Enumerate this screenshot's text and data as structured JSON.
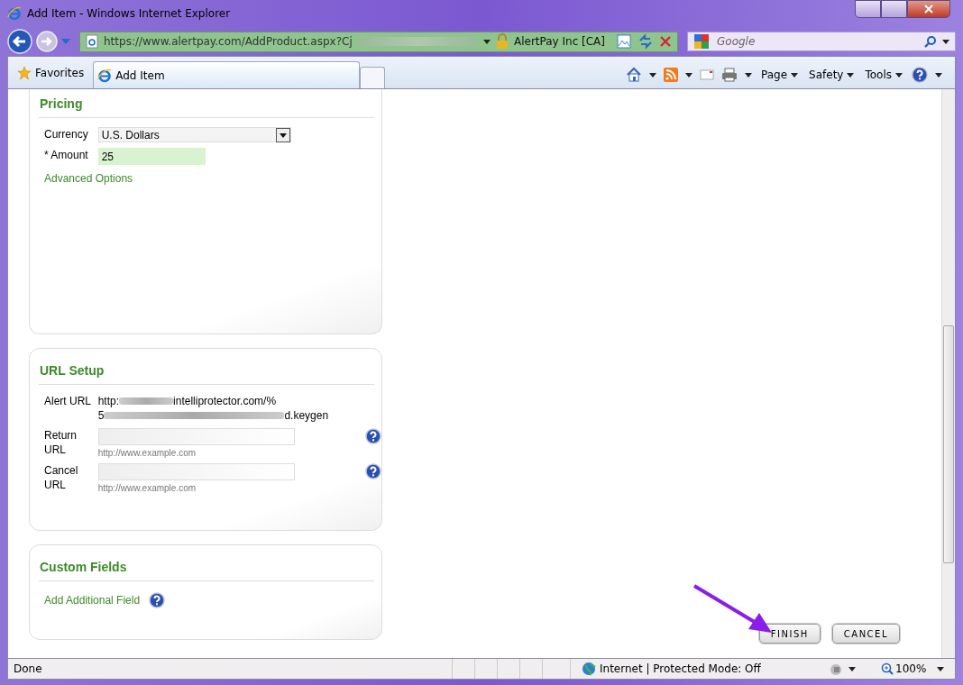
{
  "window": {
    "title": "Add Item - Windows Internet Explorer"
  },
  "address_bar": {
    "url_start": "https://www.alertpay.com/AddProduct.aspx?Cj",
    "security_label": "AlertPay Inc [CA]"
  },
  "search": {
    "placeholder": "Google"
  },
  "favorites": {
    "label": "Favorites"
  },
  "tabs": [
    {
      "label": "Add Item",
      "selected": true
    }
  ],
  "command_bar": {
    "menus": [
      "Page",
      "Safety",
      "Tools"
    ]
  },
  "sections": [
    {
      "kind": "pricing",
      "title": "Pricing",
      "cut_top": true,
      "rows": [
        {
          "kind": "select",
          "label": "Currency",
          "value": "U.S. Dollars"
        },
        {
          "kind": "input",
          "label": "* Amount",
          "value": "25",
          "highlighted": true
        }
      ],
      "links": [
        {
          "label": "Advanced Options",
          "help": false
        }
      ]
    },
    {
      "kind": "url_setup",
      "title": "URL Setup",
      "rows": [
        {
          "kind": "text",
          "label": "Alert URL",
          "lines": [
            {
              "before": "http:",
              "after": "intelliprotector.com/%"
            },
            {
              "before": "5",
              "after": "d.keygen"
            }
          ]
        },
        {
          "kind": "input",
          "label": "Return URL",
          "value_hint": "http://www.example.com",
          "help": true
        },
        {
          "kind": "input",
          "label": "Cancel URL",
          "value_hint": "http://www.example.com",
          "help": true
        }
      ]
    },
    {
      "kind": "custom",
      "title": "Custom Fields",
      "links": [
        {
          "label": "Add Additional Field",
          "help": true
        }
      ]
    }
  ],
  "buttons": [
    {
      "label": "FINISH",
      "annotated": true
    },
    {
      "label": "CANCEL",
      "annotated": false
    }
  ],
  "status_bar": {
    "text": "Done",
    "zone": "Internet | Protected Mode: Off",
    "zoom": "100%"
  }
}
